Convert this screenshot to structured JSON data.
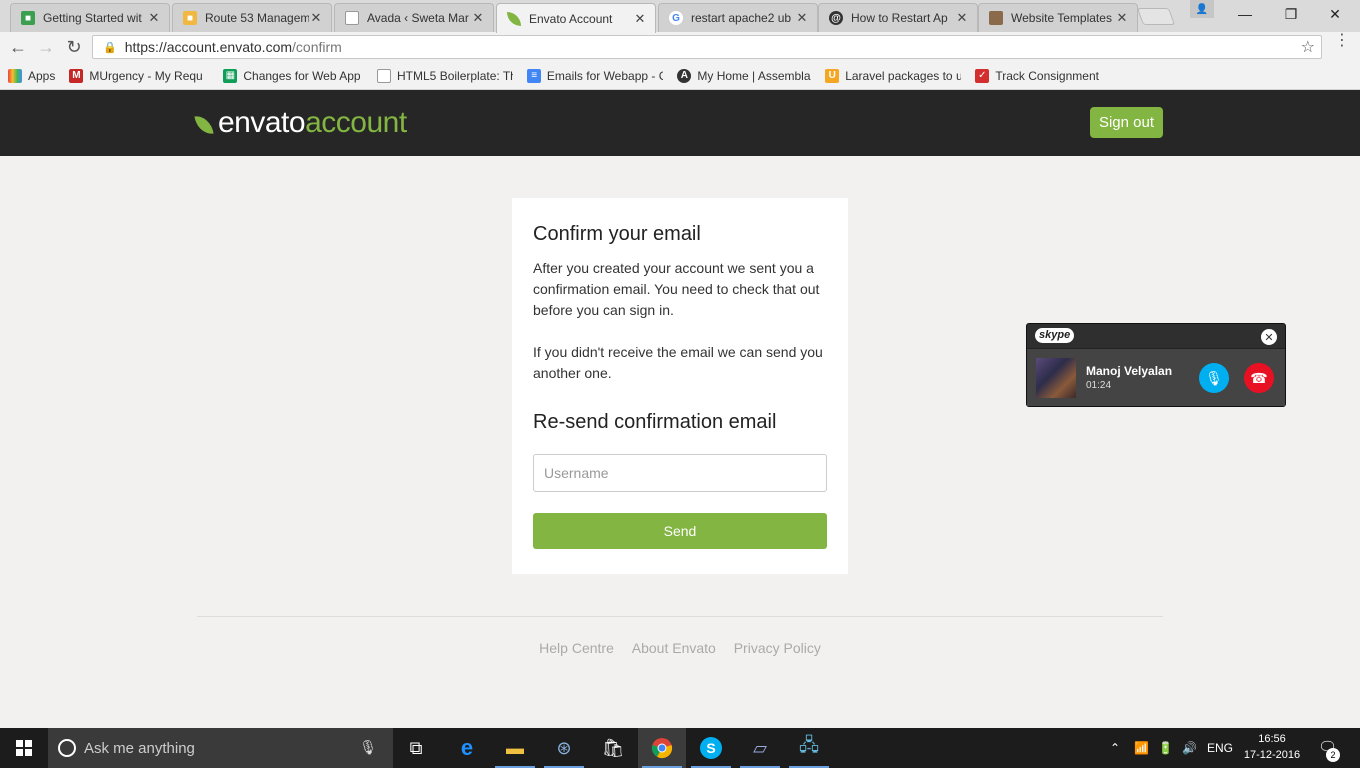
{
  "browser": {
    "tabs": [
      {
        "title": "Getting Started wit",
        "icon": "cube-icon",
        "color": "#3c9f4f"
      },
      {
        "title": "Route 53 Managem",
        "icon": "box-icon",
        "color": "#f0b840"
      },
      {
        "title": "Avada ‹ Sweta Mar",
        "icon": "page-icon",
        "color": "#999999"
      },
      {
        "title": "Envato Account",
        "icon": "leaf-icon",
        "color": "#82b541"
      },
      {
        "title": "restart apache2 ub",
        "icon": "google-icon",
        "color": "#4285f4"
      },
      {
        "title": "How to Restart Ap",
        "icon": "swirl-icon",
        "color": "#333333"
      },
      {
        "title": "Website Templates",
        "icon": "template-icon",
        "color": "#8a6a4a"
      }
    ],
    "url_host": "https://account.envato.com",
    "url_path": "/confirm",
    "bookmarks": [
      {
        "label": "Apps",
        "icon": "apps-grid-icon",
        "color": "#e8453c"
      },
      {
        "label": "MUrgency - My Requ",
        "icon": "m-icon",
        "color": "#c62828"
      },
      {
        "label": "Changes for Web App",
        "icon": "sheets-icon",
        "color": "#0f9d58"
      },
      {
        "label": "HTML5 Boilerplate: Th",
        "icon": "page-icon",
        "color": "#999999"
      },
      {
        "label": "Emails for Webapp - C",
        "icon": "docs-icon",
        "color": "#4285f4"
      },
      {
        "label": "My Home | Assembla",
        "icon": "assembla-icon",
        "color": "#333333"
      },
      {
        "label": "Laravel packages to u",
        "icon": "magnet-icon",
        "color": "#f5a623"
      },
      {
        "label": "Track Consignment",
        "icon": "courier-icon",
        "color": "#d32f2f"
      }
    ]
  },
  "envato": {
    "logo_envato": "envato",
    "logo_account": "account",
    "signout_label": "Sign out",
    "accent": "#82b541"
  },
  "card": {
    "title": "Confirm your email",
    "paragraph1": "After you created your account we sent you a confirmation email. You need to check that out before you can sign in.",
    "paragraph2": "If you didn't receive the email we can send you another one.",
    "resend_title": "Re-send confirmation email",
    "username_placeholder": "Username",
    "username_value": "",
    "send_label": "Send"
  },
  "footer": {
    "links": [
      "Help Centre",
      "About Envato",
      "Privacy Policy"
    ]
  },
  "skype": {
    "logo": "skype",
    "caller": "Manoj Velyalan",
    "duration": "01:24"
  },
  "taskbar": {
    "search_placeholder": "Ask me anything",
    "language": "ENG",
    "time": "16:56",
    "date": "17-12-2016",
    "notification_count": "2"
  }
}
